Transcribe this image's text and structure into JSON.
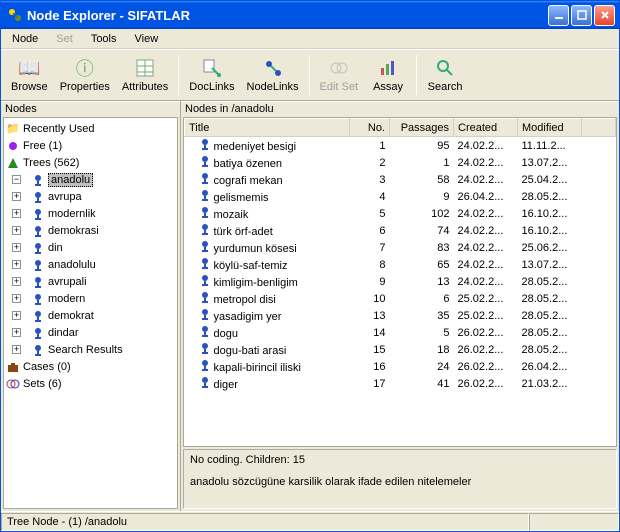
{
  "window": {
    "title": "Node Explorer - SIFATLAR"
  },
  "menu": {
    "node": "Node",
    "set": "Set",
    "tools": "Tools",
    "view": "View"
  },
  "toolbar": {
    "browse": "Browse",
    "properties": "Properties",
    "attributes": "Attributes",
    "doclinks": "DocLinks",
    "nodelinks": "NodeLinks",
    "editset": "Edit Set",
    "assay": "Assay",
    "search": "Search"
  },
  "panes": {
    "left_header": "Nodes",
    "right_header": "Nodes in /anadolu"
  },
  "tree": {
    "recently_used": "Recently Used",
    "free": "Free (1)",
    "trees": "Trees (562)",
    "items": [
      "anadolu",
      "avrupa",
      "modernlik",
      "demokrasi",
      "din",
      "anadolulu",
      "avrupali",
      "modern",
      "demokrat",
      "dindar",
      "Search Results"
    ],
    "cases": "Cases (0)",
    "sets": "Sets (6)"
  },
  "columns": {
    "title": "Title",
    "no": "No.",
    "passages": "Passages",
    "created": "Created",
    "modified": "Modified"
  },
  "rows": [
    {
      "title": "medeniyet besigi",
      "no": 1,
      "passages": 95,
      "created": "24.02.2...",
      "modified": "11.11.2..."
    },
    {
      "title": "batiya özenen",
      "no": 2,
      "passages": 1,
      "created": "24.02.2...",
      "modified": "13.07.2..."
    },
    {
      "title": "cografi mekan",
      "no": 3,
      "passages": 58,
      "created": "24.02.2...",
      "modified": "25.04.2..."
    },
    {
      "title": "gelismemis",
      "no": 4,
      "passages": 9,
      "created": "26.04.2...",
      "modified": "28.05.2..."
    },
    {
      "title": "mozaik",
      "no": 5,
      "passages": 102,
      "created": "24.02.2...",
      "modified": "16.10.2..."
    },
    {
      "title": "türk örf-adet",
      "no": 6,
      "passages": 74,
      "created": "24.02.2...",
      "modified": "16.10.2..."
    },
    {
      "title": "yurdumun kösesi",
      "no": 7,
      "passages": 83,
      "created": "24.02.2...",
      "modified": "25.06.2..."
    },
    {
      "title": "köylü-saf-temiz",
      "no": 8,
      "passages": 65,
      "created": "24.02.2...",
      "modified": "13.07.2..."
    },
    {
      "title": "kimligim-benligim",
      "no": 9,
      "passages": 13,
      "created": "24.02.2...",
      "modified": "28.05.2..."
    },
    {
      "title": "metropol disi",
      "no": 10,
      "passages": 6,
      "created": "25.02.2...",
      "modified": "28.05.2..."
    },
    {
      "title": "yasadigim yer",
      "no": 13,
      "passages": 35,
      "created": "25.02.2...",
      "modified": "28.05.2..."
    },
    {
      "title": "dogu",
      "no": 14,
      "passages": 5,
      "created": "26.02.2...",
      "modified": "28.05.2..."
    },
    {
      "title": "dogu-bati arasi",
      "no": 15,
      "passages": 18,
      "created": "26.02.2...",
      "modified": "28.05.2..."
    },
    {
      "title": "kapali-birincil iliski",
      "no": 16,
      "passages": 24,
      "created": "26.02.2...",
      "modified": "26.04.2..."
    },
    {
      "title": "diger",
      "no": 17,
      "passages": 41,
      "created": "26.02.2...",
      "modified": "21.03.2..."
    }
  ],
  "info": {
    "line1": "No coding. Children: 15",
    "line2": "anadolu sözcügüne karsilik olarak ifade edilen nitelemeler"
  },
  "status": {
    "text": "Tree Node - (1) /anadolu"
  }
}
